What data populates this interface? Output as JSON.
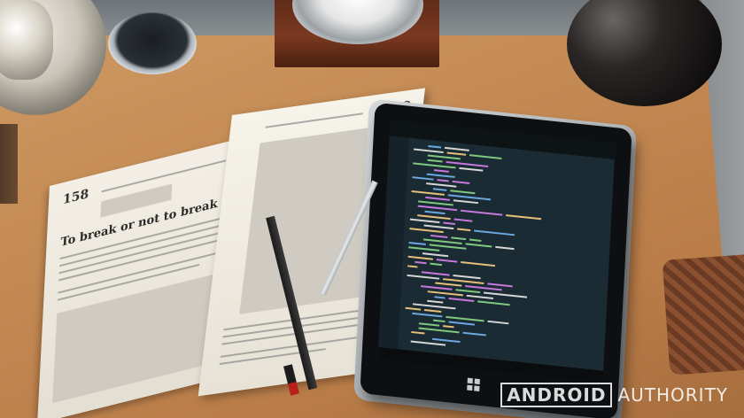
{
  "scene": {
    "description_objects": [
      "desk-lamp",
      "wireless-charger",
      "desk-clock",
      "vase",
      "carved-box",
      "open-book",
      "pencil",
      "stylus",
      "tablet"
    ]
  },
  "book": {
    "left_page_number": "158",
    "left_heading": "To break or not to break",
    "right_page_number": "159"
  },
  "watermark": {
    "word1": "ANDROID",
    "word2": "AUTHORITY"
  },
  "colors": {
    "desk": "#c48a54",
    "tablet_screen": "#1b2b33",
    "code_green": "#7fc97f",
    "code_blue": "#6aa8e0"
  }
}
